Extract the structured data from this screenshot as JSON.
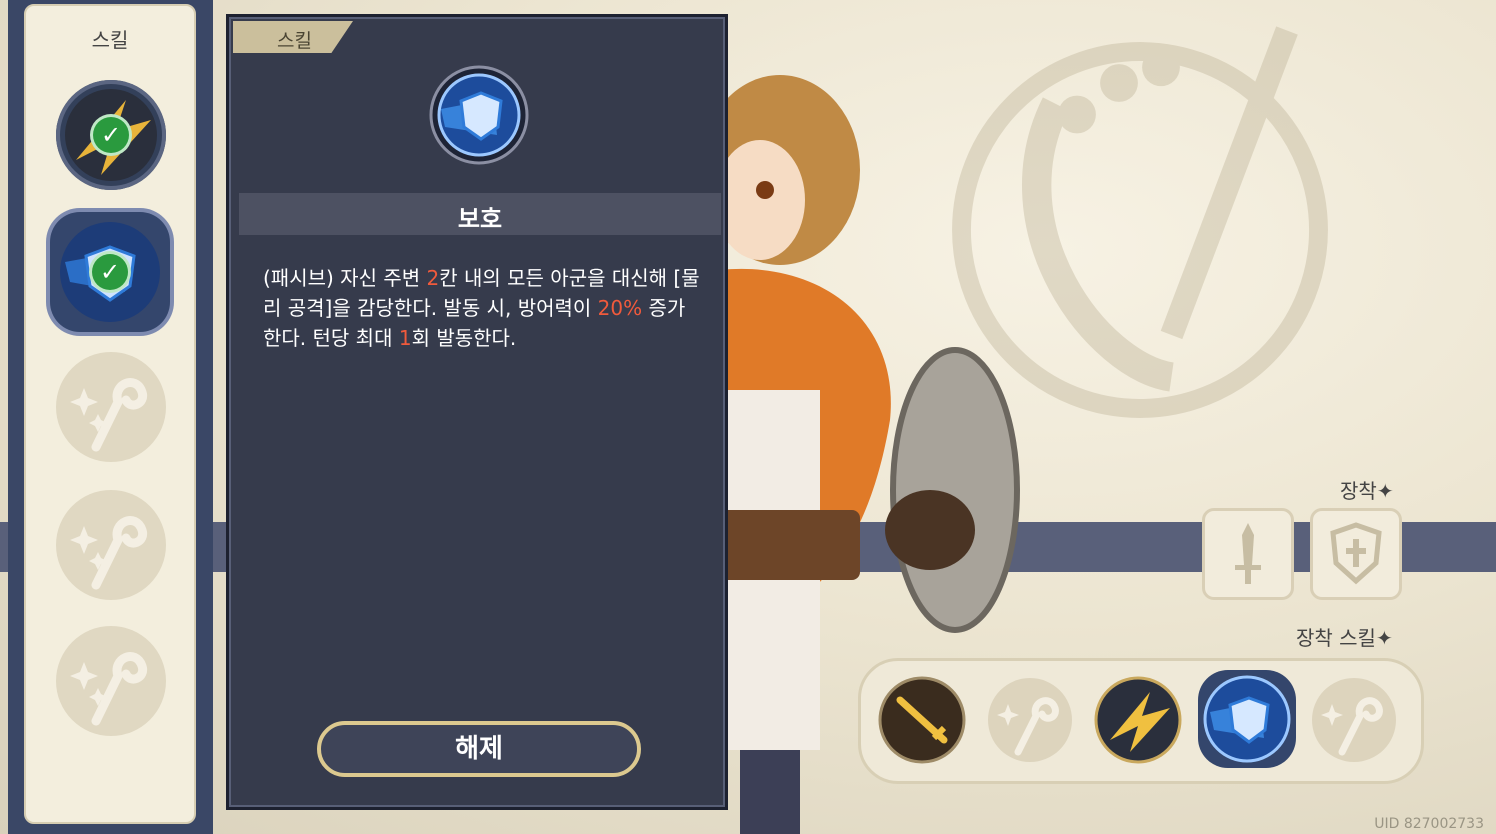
{
  "skill_list": {
    "title": "스킬",
    "slots": [
      {
        "state": "equipped",
        "icon": "golden-burst-icon"
      },
      {
        "state": "equipped-selected",
        "icon": "shield-dash-icon"
      },
      {
        "state": "locked",
        "icon": "staff-sparkle-icon"
      },
      {
        "state": "locked",
        "icon": "staff-sparkle-icon"
      },
      {
        "state": "locked",
        "icon": "staff-sparkle-icon"
      }
    ]
  },
  "detail": {
    "tab_label": "스킬",
    "skill_name": "보호",
    "desc_parts": {
      "p1": "(패시브) 자신 주변 ",
      "v1": "2",
      "p2": "칸 내의 모든 아군을 대신해 [물리 공격]을 감당한다. 발동 시, 방어력이 ",
      "v2": "20%",
      "p3": " 증가한다. 턴당 최대 ",
      "v3": "1",
      "p4": "회 발동한다."
    },
    "button_label": "해제"
  },
  "equipment": {
    "label": "장착",
    "items": [
      {
        "icon": "sword-icon"
      },
      {
        "icon": "shield-cross-icon"
      }
    ]
  },
  "equipped_skills": {
    "label": "장착 스킬",
    "slots": [
      {
        "icon": "golden-sword-icon"
      },
      {
        "icon": "staff-sparkle-icon"
      },
      {
        "icon": "golden-burst-icon"
      },
      {
        "icon": "shield-dash-icon"
      },
      {
        "icon": "staff-sparkle-icon"
      }
    ]
  },
  "footer": {
    "uid": "UID 827002733"
  },
  "colors": {
    "highlight": "#f05a3c",
    "panel": "#363b4c",
    "accent_blue": "#2f7bd9"
  }
}
